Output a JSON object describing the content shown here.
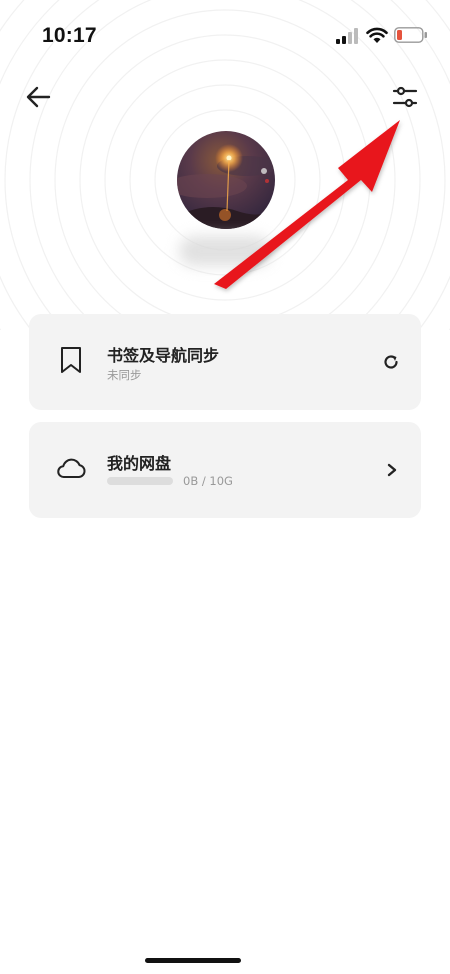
{
  "status_bar": {
    "time": "10:17",
    "icons": [
      "cellular-signal-icon",
      "wifi-icon",
      "battery-low-icon"
    ],
    "battery_color": "#e5533d"
  },
  "header": {
    "back_icon": "arrow-left-icon",
    "settings_icon": "sliders-icon"
  },
  "profile": {
    "avatar": "avatar-image"
  },
  "cards": [
    {
      "icon": "bookmark-icon",
      "title": "书签及导航同步",
      "subtitle": "未同步",
      "action_icon": "refresh-icon"
    },
    {
      "icon": "cloud-icon",
      "title": "我的网盘",
      "storage_text": "0B / 10G",
      "storage_used_fraction": 0,
      "action_icon": "chevron-right-icon"
    }
  ],
  "annotation": {
    "type": "arrow",
    "color": "#e8141b",
    "points_to": "settings-button"
  },
  "colors": {
    "card_bg": "#f3f3f3",
    "text_primary": "#222222",
    "text_secondary": "#999999"
  }
}
